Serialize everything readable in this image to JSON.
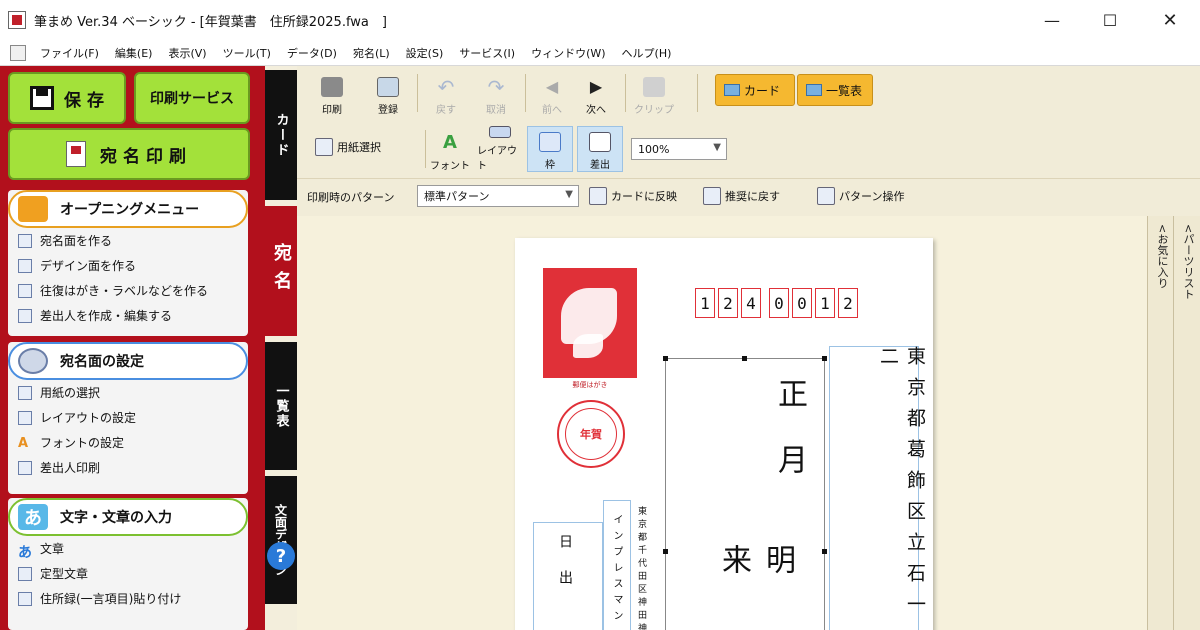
{
  "window": {
    "title": "筆まめ Ver.34 ベーシック - [年賀葉書　住所録2025.fwa　]",
    "min_glyph": "—",
    "max_glyph": "☐",
    "close_glyph": "✕"
  },
  "menu": [
    "ファイル(F)",
    "編集(E)",
    "表示(V)",
    "ツール(T)",
    "データ(D)",
    "宛名(L)",
    "設定(S)",
    "サービス(I)",
    "ウィンドウ(W)",
    "ヘルプ(H)"
  ],
  "left": {
    "save": "保 存",
    "print_service": "印刷サービス",
    "atena_print": "宛名印刷",
    "opening": {
      "title": "オープニングメニュー",
      "items": [
        "宛名面を作る",
        "デザイン面を作る",
        "往復はがき・ラベルなどを作る",
        "差出人を作成・編集する"
      ]
    },
    "atena_settings": {
      "title": "宛名面の設定",
      "items": [
        "用紙の選択",
        "レイアウトの設定",
        "フォントの設定",
        "差出人印刷"
      ]
    },
    "text_input": {
      "title": "文字・文章の入力",
      "icon_glyph": "あ",
      "items": [
        "文章",
        "定型文章",
        "住所録(一言項目)貼り付け"
      ]
    }
  },
  "tabs": [
    "カード",
    "宛名",
    "一覧表",
    "文面デザイン"
  ],
  "help_glyph": "?",
  "toolbar1": {
    "print": "印刷",
    "register": "登録",
    "undo": "戻す",
    "redo": "取消",
    "prev": "前へ",
    "next": "次へ",
    "clip": "クリップ",
    "undo_glyph": "↶",
    "redo_glyph": "↷",
    "prev_glyph": "◀",
    "next_glyph": "▶",
    "card_view": "カード",
    "list_view": "一覧表"
  },
  "toolbar2": {
    "paper_select": "用紙選択",
    "font": "フォント",
    "font_glyph": "A",
    "layout": "レイアウト",
    "frame": "枠",
    "sender": "差出",
    "zoom": "100%"
  },
  "toolbar3": {
    "pattern_label": "印刷時のパターン",
    "pattern_value": "標準パターン",
    "reflect": "カードに反映",
    "reset": "推奨に戻す",
    "pattern_op": "パターン操作"
  },
  "card": {
    "postal_digits": [
      "1",
      "2",
      "4",
      "0",
      "0",
      "1",
      "2"
    ],
    "stamp_caption": "郵便はがき",
    "nenga_mark": "年賀",
    "recipient_name": "正月",
    "recipient_name2": "明来",
    "address": "東京都葛飾区立石一二",
    "sender_name": "日出",
    "sender_company": "インプレスマン",
    "sender_address": "東京都千代田区神田神"
  },
  "rails": {
    "favorites": "<お気に入り",
    "parts_list": "<パーツリスト"
  }
}
